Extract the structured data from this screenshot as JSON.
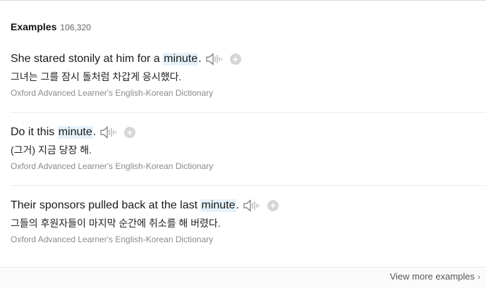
{
  "header": {
    "title": "Examples",
    "count": "106,320"
  },
  "examples": [
    {
      "pre": "She stared stonily at him for a ",
      "highlight": "minute",
      "post": ".",
      "translation": "그녀는 그를 잠시 돌처럼 차갑게 응시했다.",
      "source": "Oxford Advanced Learner's English-Korean Dictionary"
    },
    {
      "pre": "Do it this ",
      "highlight": "minute",
      "post": ".",
      "translation": "(그거) 지금 당장 해.",
      "source": "Oxford Advanced Learner's English-Korean Dictionary"
    },
    {
      "pre": "Their sponsors pulled back at the last ",
      "highlight": "minute",
      "post": ".",
      "translation": "그들의 후원자들이 마지막 순간에 취소를 해 버렸다.",
      "source": "Oxford Advanced Learner's English-Korean Dictionary"
    }
  ],
  "icons": {
    "speaker": "speaker-icon",
    "add": "plus-circle-icon",
    "chevron": "chevron-right-icon"
  },
  "plus_symbol": "+",
  "footer": {
    "view_more": "View more examples",
    "chevron": "›"
  },
  "colors": {
    "highlight": "#e6f2fb",
    "source_text": "#8a8a8a",
    "icon_gray": "#d6d6d6"
  }
}
